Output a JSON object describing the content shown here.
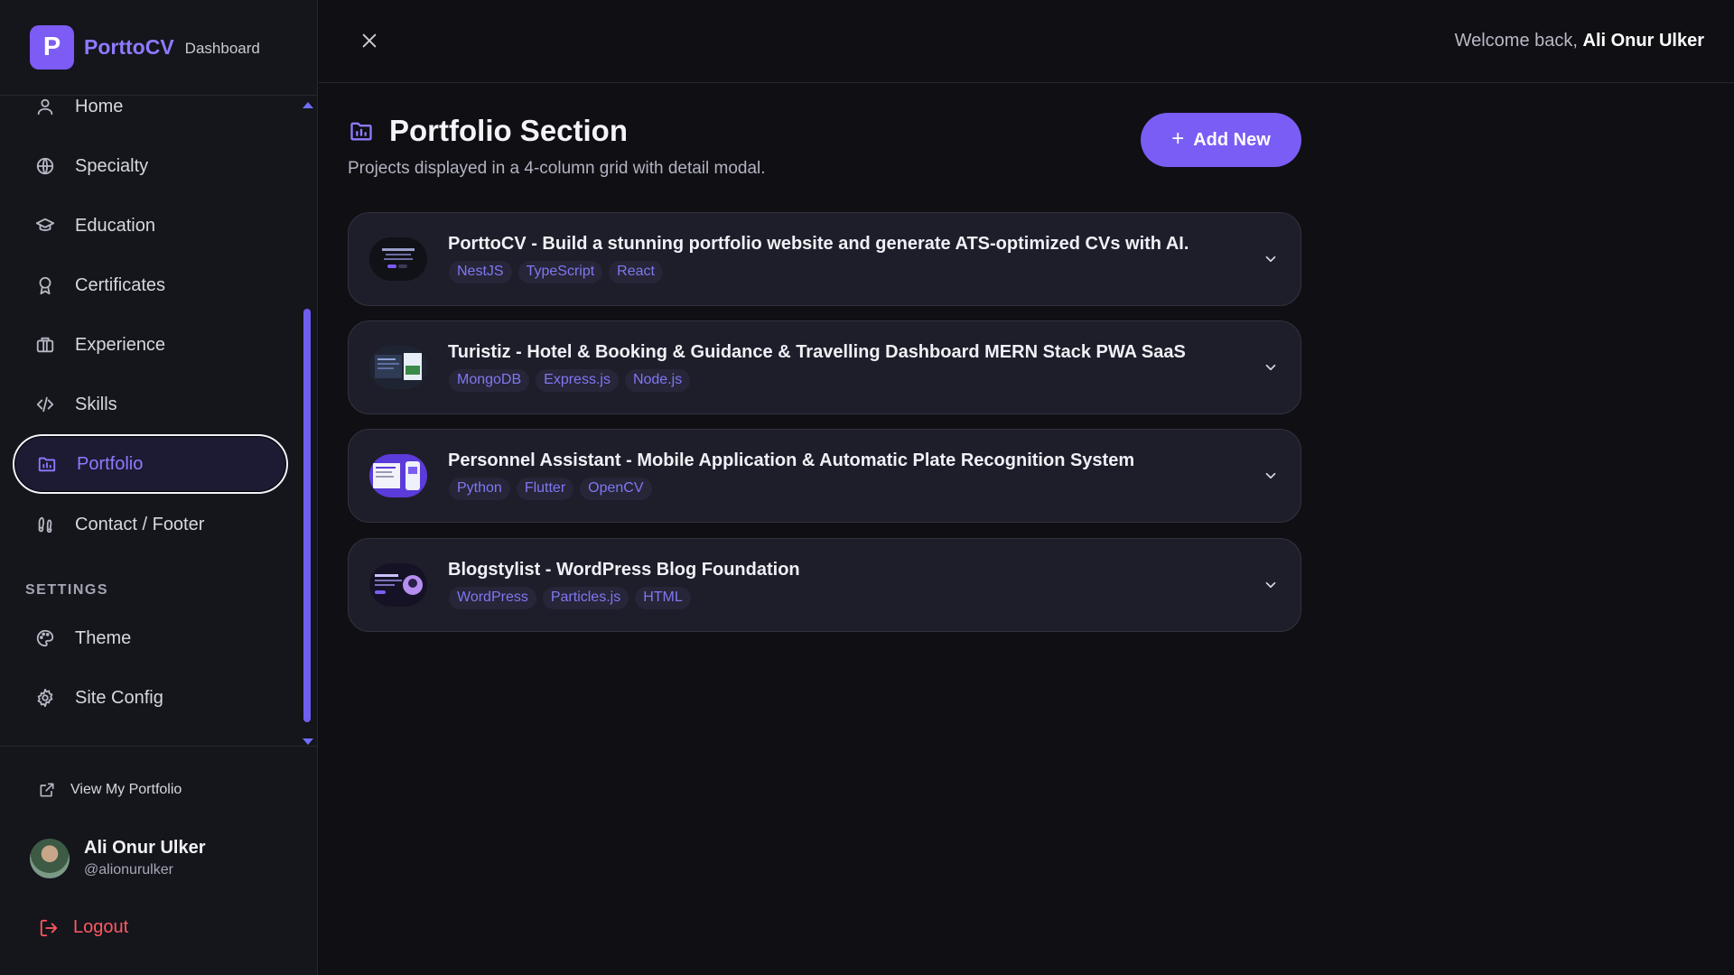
{
  "brand": {
    "logo_letter": "P",
    "name": "PorttoCV",
    "subtitle": "Dashboard"
  },
  "sidebar": {
    "items": [
      {
        "label": "Home",
        "icon": "user-icon"
      },
      {
        "label": "Specialty",
        "icon": "globe-icon"
      },
      {
        "label": "Education",
        "icon": "graduation-cap-icon"
      },
      {
        "label": "Certificates",
        "icon": "award-icon"
      },
      {
        "label": "Experience",
        "icon": "briefcase-icon"
      },
      {
        "label": "Skills",
        "icon": "code-icon"
      },
      {
        "label": "Portfolio",
        "icon": "folder-chart-icon",
        "active": true
      },
      {
        "label": "Contact / Footer",
        "icon": "footprints-icon"
      }
    ],
    "settings_label": "SETTINGS",
    "settings_items": [
      {
        "label": "Theme",
        "icon": "palette-icon"
      },
      {
        "label": "Site Config",
        "icon": "gear-icon"
      }
    ],
    "view_portfolio": "View My Portfolio",
    "user": {
      "name": "Ali Onur Ulker",
      "handle": "@alionurulker"
    },
    "logout": "Logout"
  },
  "topbar": {
    "welcome_prefix": "Welcome back,",
    "welcome_name": "Ali Onur Ulker"
  },
  "main": {
    "title": "Portfolio Section",
    "subtitle": "Projects displayed in a 4-column grid with detail modal.",
    "add_button": "Add New",
    "projects": [
      {
        "title": "PorttoCV - Build a stunning portfolio website and generate ATS-optimized CVs with AI.",
        "tags": [
          "NestJS",
          "TypeScript",
          "React"
        ]
      },
      {
        "title": "Turistiz - Hotel & Booking & Guidance & Travelling Dashboard MERN Stack PWA SaaS",
        "tags": [
          "MongoDB",
          "Express.js",
          "Node.js"
        ]
      },
      {
        "title": "Personnel Assistant - Mobile Application & Automatic Plate Recognition System",
        "tags": [
          "Python",
          "Flutter",
          "OpenCV"
        ]
      },
      {
        "title": "Blogstylist - WordPress Blog Foundation",
        "tags": [
          "WordPress",
          "Particles.js",
          "HTML"
        ]
      }
    ]
  },
  "colors": {
    "accent": "#7a5df5",
    "accent_text": "#8d7bff",
    "danger": "#ff5a5f",
    "background": "#0f0f14",
    "card": "#1e1e2a"
  }
}
